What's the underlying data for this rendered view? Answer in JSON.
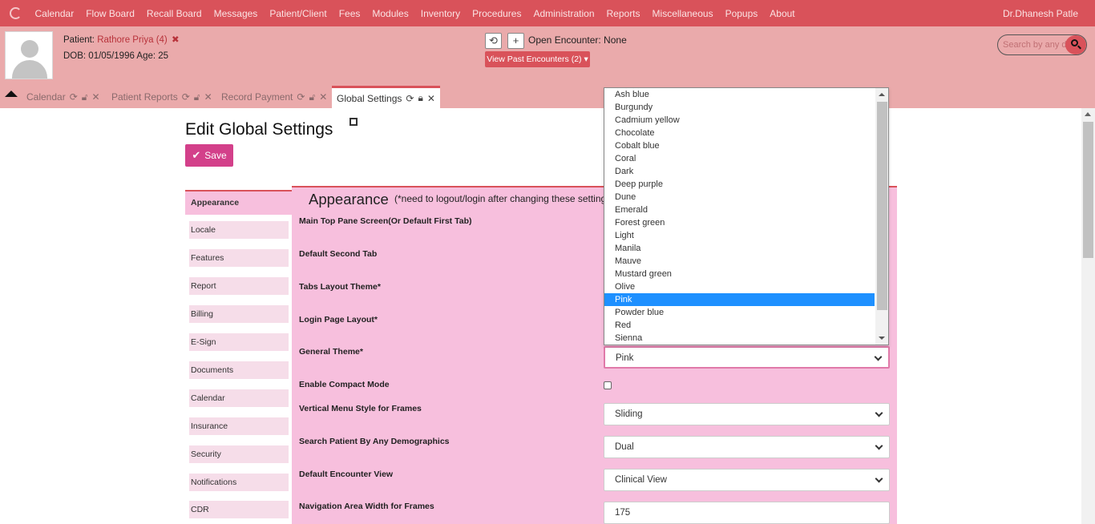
{
  "topnav": {
    "menu": [
      "Calendar",
      "Flow Board",
      "Recall Board",
      "Messages",
      "Patient/Client",
      "Fees",
      "Modules",
      "Inventory",
      "Procedures",
      "Administration",
      "Reports",
      "Miscellaneous",
      "Popups",
      "About"
    ],
    "user": "Dr.Dhanesh Patle"
  },
  "patient": {
    "label": "Patient:",
    "name": "Rathore Priya (4)",
    "dob_line": "DOB: 01/05/1996 Age: 25"
  },
  "encounter": {
    "open_text": "Open Encounter: None",
    "past_button": "View Past Encounters  (2) ▾"
  },
  "search": {
    "placeholder": "Search by any de"
  },
  "tabs": [
    {
      "label": "Calendar"
    },
    {
      "label": "Patient Reports"
    },
    {
      "label": "Record Payment"
    },
    {
      "label": "Global Settings"
    }
  ],
  "page": {
    "title": "Edit Global Settings",
    "save_label": "Save",
    "section_title": "Appearance",
    "section_note": "(*need to logout/login after changing these settings)"
  },
  "leftmenu": [
    "Appearance",
    "Locale",
    "Features",
    "Report",
    "Billing",
    "E-Sign",
    "Documents",
    "Calendar",
    "Insurance",
    "Security",
    "Notifications",
    "CDR"
  ],
  "settings": {
    "main_top_pane": "Main Top Pane Screen(Or Default First Tab)",
    "default_second_tab": "Default Second Tab",
    "tabs_layout_theme": "Tabs Layout Theme*",
    "login_page_layout": "Login Page Layout*",
    "general_theme_label": "General Theme*",
    "general_theme_value": "Pink",
    "compact_mode_label": "Enable Compact Mode",
    "vertical_menu_label": "Vertical Menu Style for Frames",
    "vertical_menu_value": "Sliding",
    "search_patient_label": "Search Patient By Any Demographics",
    "search_patient_value": "Dual",
    "encounter_view_label": "Default Encounter View",
    "encounter_view_value": "Clinical View",
    "nav_width_label": "Navigation Area Width for Frames",
    "nav_width_value": "175"
  },
  "theme_options": [
    "Ash blue",
    "Burgundy",
    "Cadmium yellow",
    "Chocolate",
    "Cobalt blue",
    "Coral",
    "Dark",
    "Deep purple",
    "Dune",
    "Emerald",
    "Forest green",
    "Light",
    "Manila",
    "Mauve",
    "Mustard green",
    "Olive",
    "Pink",
    "Powder blue",
    "Red",
    "Sienna"
  ],
  "theme_selected_index": 16,
  "colors": {
    "nav": "#d9525a",
    "header": "#eaaaab",
    "panel": "#f7bfdd",
    "save": "#d3408a",
    "highlight": "#1e90ff"
  }
}
